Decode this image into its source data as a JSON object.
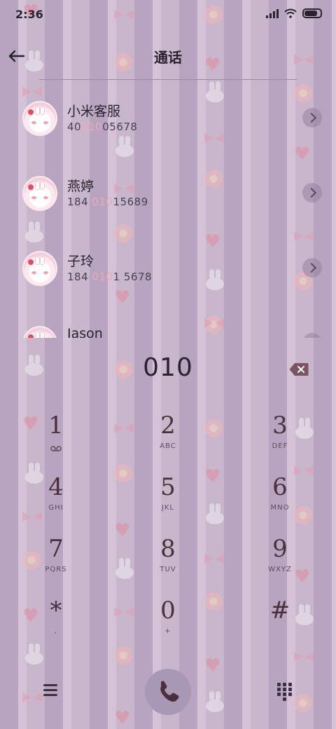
{
  "status_bar": {
    "time": "2:36"
  },
  "header": {
    "title": "通话"
  },
  "contacts": [
    {
      "name": "小米客服",
      "num_pre": "40",
      "num_match": "010",
      "num_post": "05678"
    },
    {
      "name": "燕婷",
      "num_pre": "184 ",
      "num_match": "010",
      "num_post": "15689"
    },
    {
      "name": "子玲",
      "num_pre": "184 ",
      "num_match": "010",
      "num_post": "1 5678"
    },
    {
      "name": "Jason",
      "num_pre": "",
      "num_match": "",
      "num_post": ""
    }
  ],
  "dialer": {
    "input": "010",
    "keys": [
      {
        "digit": "1",
        "letters": ""
      },
      {
        "digit": "2",
        "letters": "ABC"
      },
      {
        "digit": "3",
        "letters": "DEF"
      },
      {
        "digit": "4",
        "letters": "GHI"
      },
      {
        "digit": "5",
        "letters": "JKL"
      },
      {
        "digit": "6",
        "letters": "MNO"
      },
      {
        "digit": "7",
        "letters": "PQRS"
      },
      {
        "digit": "8",
        "letters": "TUV"
      },
      {
        "digit": "9",
        "letters": "WXYZ"
      },
      {
        "digit": "*",
        "letters": ","
      },
      {
        "digit": "0",
        "letters": "+"
      },
      {
        "digit": "#",
        "letters": ""
      }
    ]
  },
  "icons": {
    "back": "arrow-left-icon",
    "delete": "backspace-icon",
    "voicemail": "voicemail-icon",
    "menu": "menu-icon",
    "call": "phone-icon",
    "keypad": "dialpad-icon"
  },
  "colors": {
    "accent_highlight": "#eda6bd",
    "call_button": "#a898b6",
    "delete_icon": "#7a5460"
  }
}
